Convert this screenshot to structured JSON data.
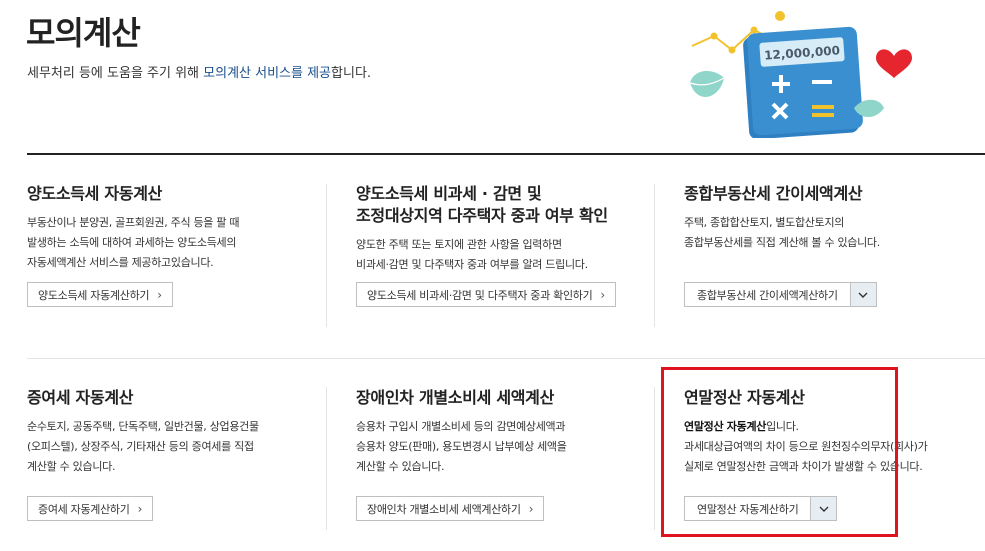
{
  "header": {
    "title": "모의계산",
    "desc_prefix": "세무처리 등에 도움을 주기 위해 ",
    "desc_highlight": "모의계산 서비스를 제공",
    "desc_suffix": "합니다.",
    "illustration_amount": "12,000,000"
  },
  "cards": [
    {
      "title": "양도소득세 자동계산",
      "desc": [
        "부동산이나 분양권, 골프회원권, 주식 등을 팔 때",
        "발생하는 소득에 대하여 과세하는 양도소득세의",
        "자동세액계산 서비스를 제공하고있습니다."
      ],
      "button": "양도소득세 자동계산하기"
    },
    {
      "title_line1": "양도소득세 비과세 · 감면 및",
      "title_line2": "조정대상지역 다주택자 중과 여부 확인",
      "desc": [
        "양도한 주택 또는 토지에 관한 사항을 입력하면",
        "비과세·감면 및 다주택자 중과 여부를 알려 드립니다."
      ],
      "button": "양도소득세 비과세·감면 및 다주택자 중과 확인하기"
    },
    {
      "title": "종합부동산세 간이세액계산",
      "desc": [
        "주택, 종합합산토지, 별도합산토지의",
        "종합부동산세를 직접 계산해 볼 수 있습니다."
      ],
      "button": "종합부동산세 간이세액계산하기"
    },
    {
      "title": "증여세 자동계산",
      "desc": [
        "순수토지, 공동주택, 단독주택, 일반건물, 상업용건물",
        "(오피스텔), 상장주식, 기타재산 등의 증여세를 직접",
        "계산할 수 있습니다."
      ],
      "button": "증여세 자동계산하기"
    },
    {
      "title": "장애인차 개별소비세 세액계산",
      "desc": [
        "승용차 구입시 개별소비세 등의 감면예상세액과",
        "승용차 양도(판매), 용도변경시 납부예상 세액을",
        "계산할 수 있습니다."
      ],
      "button": "장애인차 개별소비세 세액계산하기"
    },
    {
      "title": "연말정산 자동계산",
      "desc_bold": "연말정산 자동계산",
      "desc_bold_suffix": "입니다.",
      "desc": [
        "과세대상급여액의 차이 등으로 원천징수의무자(회사)가",
        "실제로 연말정산한 금액과 차이가 발생할 수 있습니다."
      ],
      "button": "연말정산 자동계산하기"
    }
  ],
  "colors": {
    "accent_link": "#1a4f8b",
    "highlight_border": "#e0141e",
    "calculator_body": "#3a8fd0"
  }
}
